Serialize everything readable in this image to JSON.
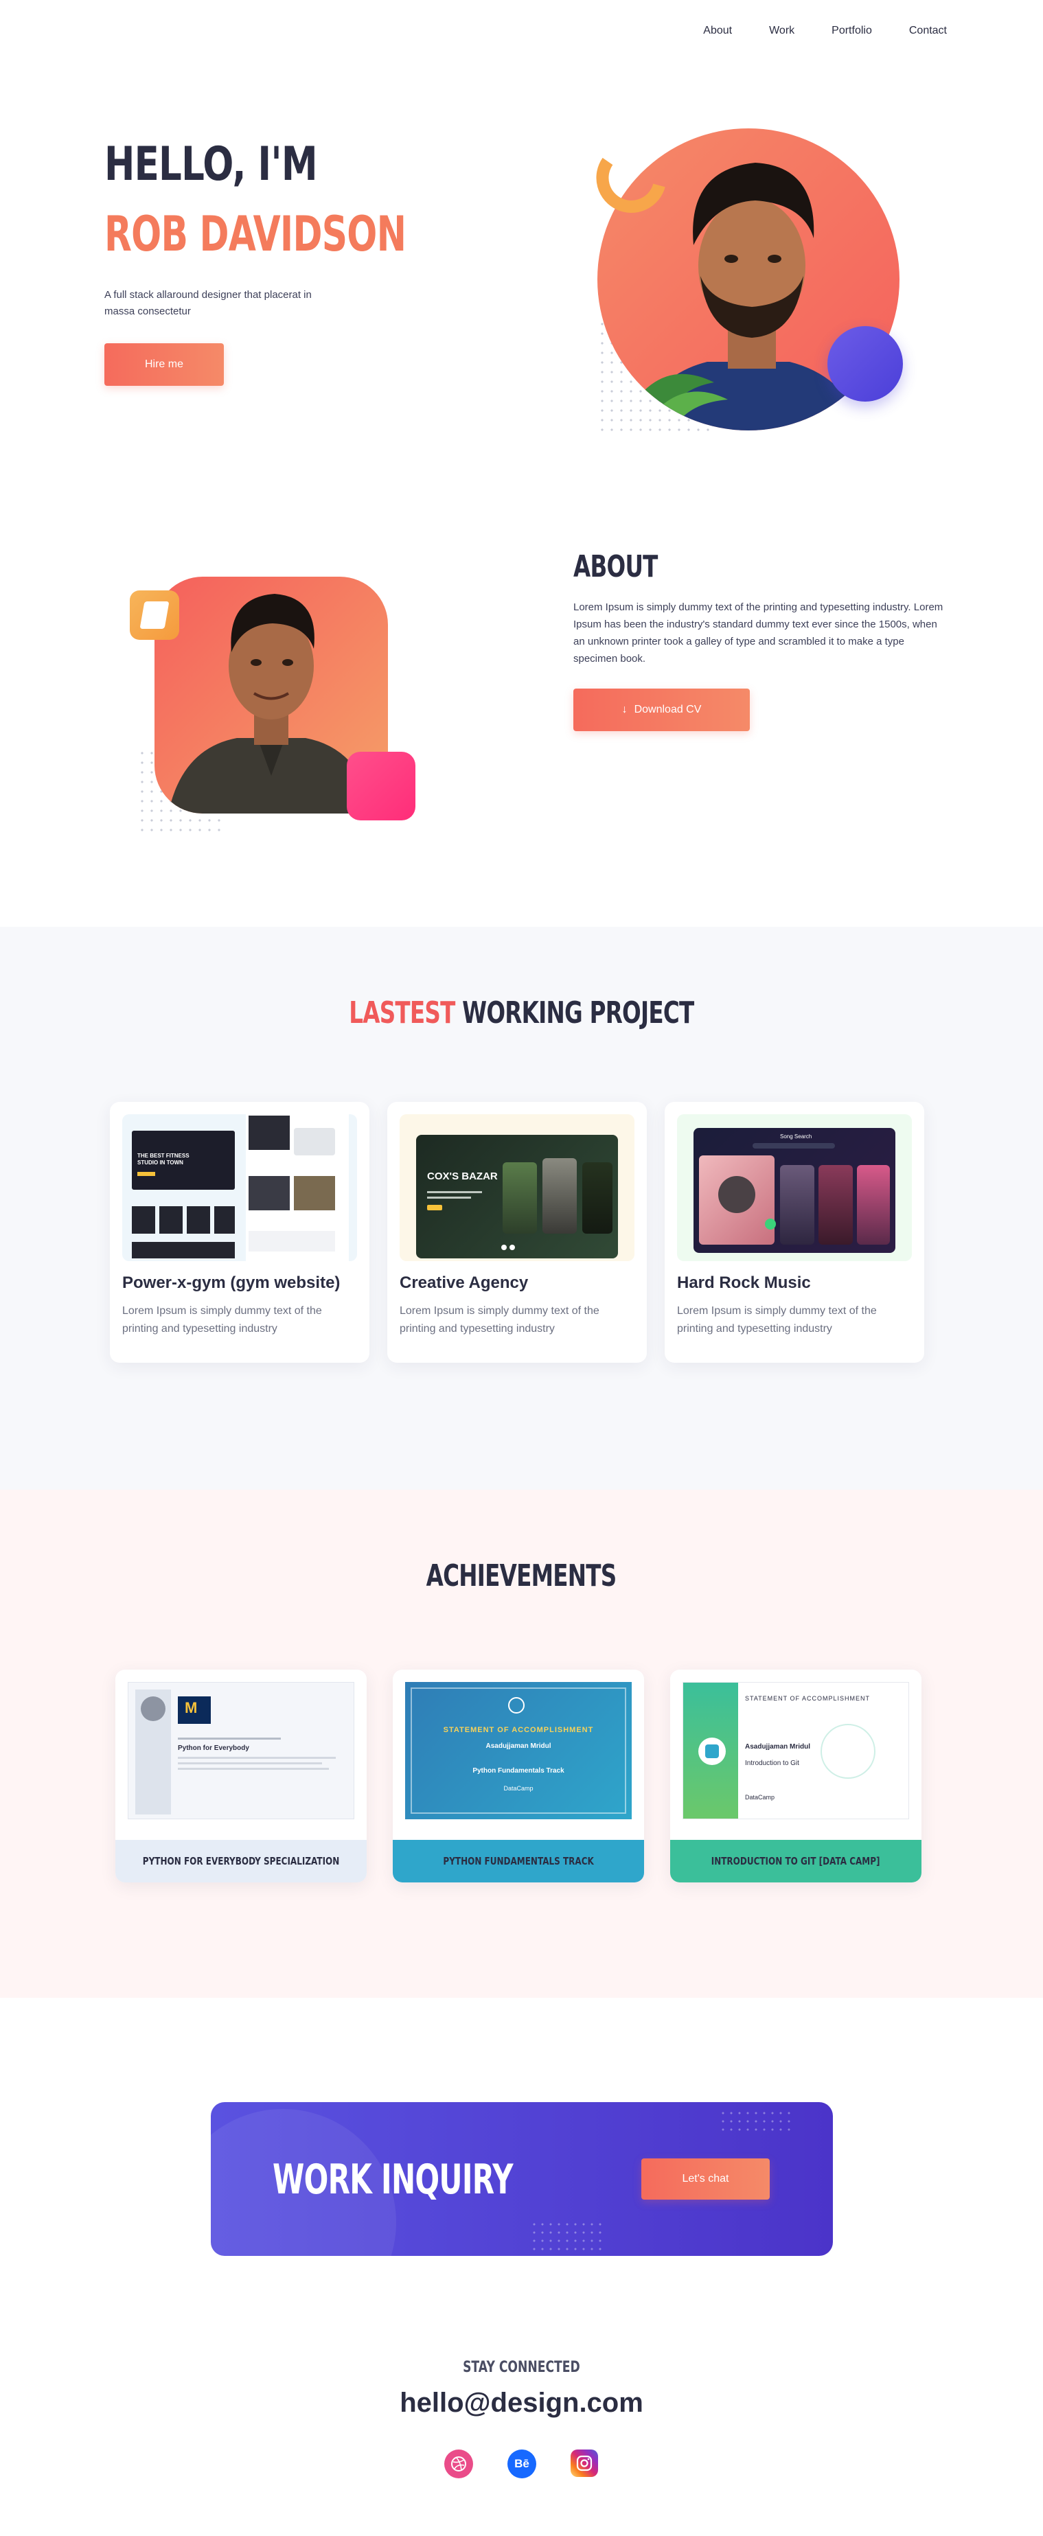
{
  "nav": {
    "items": [
      {
        "label": "About"
      },
      {
        "label": "Work"
      },
      {
        "label": "Portfolio"
      },
      {
        "label": "Contact"
      }
    ]
  },
  "hero": {
    "greeting": "HELLO, I'M",
    "name": "ROB DAVIDSON",
    "description": "A full stack allaround designer that placerat in massa consectetur",
    "cta_label": "Hire me",
    "photo_alt": "Portrait of Rob Davidson"
  },
  "about": {
    "title": "ABOUT",
    "text": "Lorem Ipsum is simply dummy text of the printing and typesetting industry. Lorem Ipsum has been the industry's standard dummy text ever since the 1500s, when an unknown printer took a galley of type and scrambled it to make a type specimen book.",
    "cv_label": "Download CV"
  },
  "projects": {
    "title_accent": "LASTEST",
    "title_rest": "WORKING PROJECT",
    "items": [
      {
        "name": "Power-x-gym (gym website)",
        "description": "Lorem Ipsum is simply dummy text of the printing and typesetting industry",
        "thumb_bg": "#eef6fb"
      },
      {
        "name": "Creative Agency",
        "description": "Lorem Ipsum is simply dummy text of the printing and typesetting industry",
        "thumb_bg": "#fdf7e8"
      },
      {
        "name": "Hard Rock Music",
        "description": "Lorem Ipsum is simply dummy text of the printing and typesetting industry",
        "thumb_bg": "#eefbf0"
      }
    ],
    "thumb_text": {
      "gym_headline": "THE BEST FITNESS STUDIO IN TOWN",
      "agency_headline": "COX'S BAZAR",
      "music_headline": "Song Search"
    }
  },
  "achievements": {
    "title": "ACHIEVEMENTS",
    "items": [
      {
        "label": "PYTHON FOR EVERYBODY SPECIALIZATION",
        "label_bg": "#e6edf7"
      },
      {
        "label": "PYTHON FUNDAMENTALS TRACK",
        "label_bg": "#2fa6cb"
      },
      {
        "label": "INTRODUCTION TO GIT [DATA CAMP]",
        "label_bg": "#3bbf9a"
      }
    ],
    "cert_text": {
      "c1_course": "Python for Everybody",
      "c2_heading": "STATEMENT OF ACCOMPLISHMENT",
      "c2_name": "Asadujjaman Mridul",
      "c2_track": "Python Fundamentals Track",
      "c2_brand": "DataCamp",
      "c3_heading": "STATEMENT OF ACCOMPLISHMENT",
      "c3_name": "Asadujjaman Mridul",
      "c3_course": "Introduction to Git",
      "c3_brand": "DataCamp"
    }
  },
  "inquiry": {
    "title": "WORK INQUIRY",
    "cta_label": "Let's chat"
  },
  "footer": {
    "stay_connected": "STAY CONNECTED",
    "email": "hello@design.com",
    "socials": [
      {
        "icon": "dribbble-icon",
        "glyph": "◎"
      },
      {
        "icon": "behance-icon",
        "glyph": "Bē"
      },
      {
        "icon": "instagram-icon",
        "glyph": "◎"
      }
    ]
  },
  "colors": {
    "accent": "#f56b5c",
    "navy": "#2b2d42",
    "purple": "#5a52e0"
  }
}
